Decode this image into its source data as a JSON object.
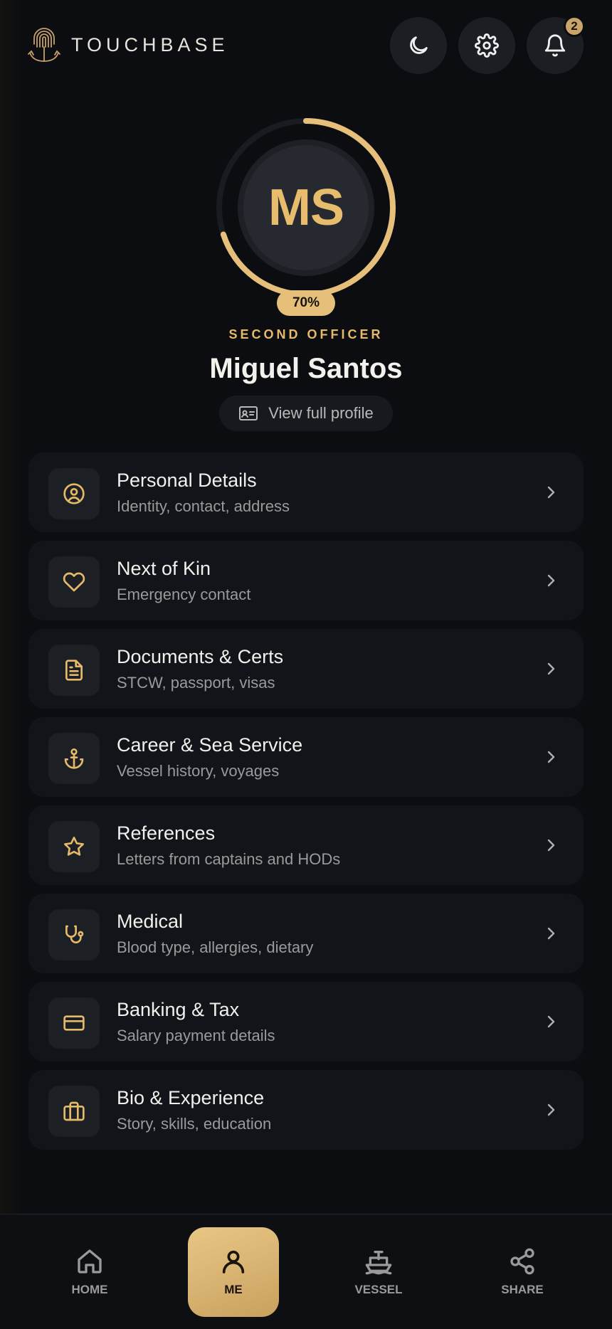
{
  "app": {
    "brand": "TOUCHBASE"
  },
  "header": {
    "notifications_count": "2"
  },
  "profile": {
    "initials": "MS",
    "completion": 70,
    "completion_label": "70%",
    "role": "SECOND OFFICER",
    "name": "Miguel Santos",
    "view_profile_label": "View full profile"
  },
  "menu": [
    {
      "title": "Personal Details",
      "subtitle": "Identity, contact, address",
      "icon": "user-circle-icon"
    },
    {
      "title": "Next of Kin",
      "subtitle": "Emergency contact",
      "icon": "heart-icon"
    },
    {
      "title": "Documents & Certs",
      "subtitle": "STCW, passport, visas",
      "icon": "document-icon"
    },
    {
      "title": "Career & Sea Service",
      "subtitle": "Vessel history, voyages",
      "icon": "anchor-icon"
    },
    {
      "title": "References",
      "subtitle": "Letters from captains and HODs",
      "icon": "star-icon"
    },
    {
      "title": "Medical",
      "subtitle": "Blood type, allergies, dietary",
      "icon": "stethoscope-icon"
    },
    {
      "title": "Banking & Tax",
      "subtitle": "Salary payment details",
      "icon": "credit-card-icon"
    },
    {
      "title": "Bio & Experience",
      "subtitle": "Story, skills, education",
      "icon": "briefcase-icon"
    }
  ],
  "nav": [
    {
      "label": "HOME",
      "icon": "home-icon"
    },
    {
      "label": "ME",
      "icon": "user-icon",
      "active": true
    },
    {
      "label": "VESSEL",
      "icon": "ship-icon"
    },
    {
      "label": "SHARE",
      "icon": "share-icon"
    }
  ],
  "colors": {
    "accent": "#e6c07a",
    "background": "#0b0d10",
    "card": "#111418"
  }
}
